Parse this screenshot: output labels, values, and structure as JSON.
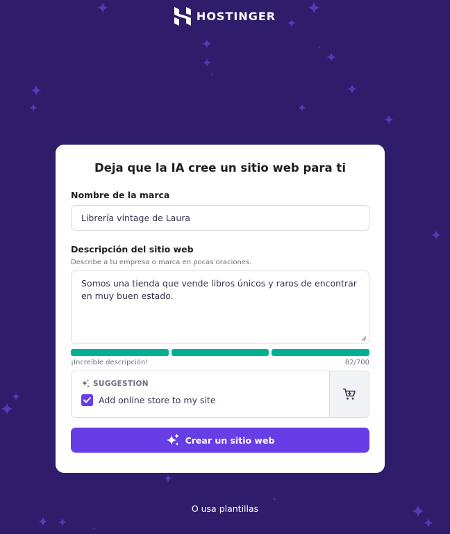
{
  "brand": {
    "name": "HOSTINGER",
    "logo_icon": "hostinger-logo-icon"
  },
  "colors": {
    "background": "#2f1c6a",
    "card": "#ffffff",
    "accent": "#673de6",
    "success": "#00b090",
    "text": "#1d1e20",
    "muted": "#6d7081"
  },
  "card": {
    "title": "Deja que la IA cree un sitio web para ti",
    "brand_name": {
      "label": "Nombre de la marca",
      "value": "Librería vintage de Laura"
    },
    "description": {
      "label": "Descripción del sitio web",
      "hint": "Describe a tu empresa o marca en pocas oraciones.",
      "value": "Somos una tienda que vende libros únicos y raros de encontrar en muy buen estado.",
      "quality_text": "¡Increíble descripción!",
      "counter": "82/700",
      "quality_level": 3,
      "quality_max": 3
    },
    "suggestion": {
      "heading": "SUGGESTION",
      "heading_icon": "sparkle-icon",
      "option_label": "Add online store to my site",
      "checked": true,
      "side_icon": "shopping-cart-icon"
    },
    "cta": {
      "label": "Crear un sitio web",
      "icon": "sparkles-icon"
    }
  },
  "footer": {
    "link": "O usa plantillas"
  }
}
